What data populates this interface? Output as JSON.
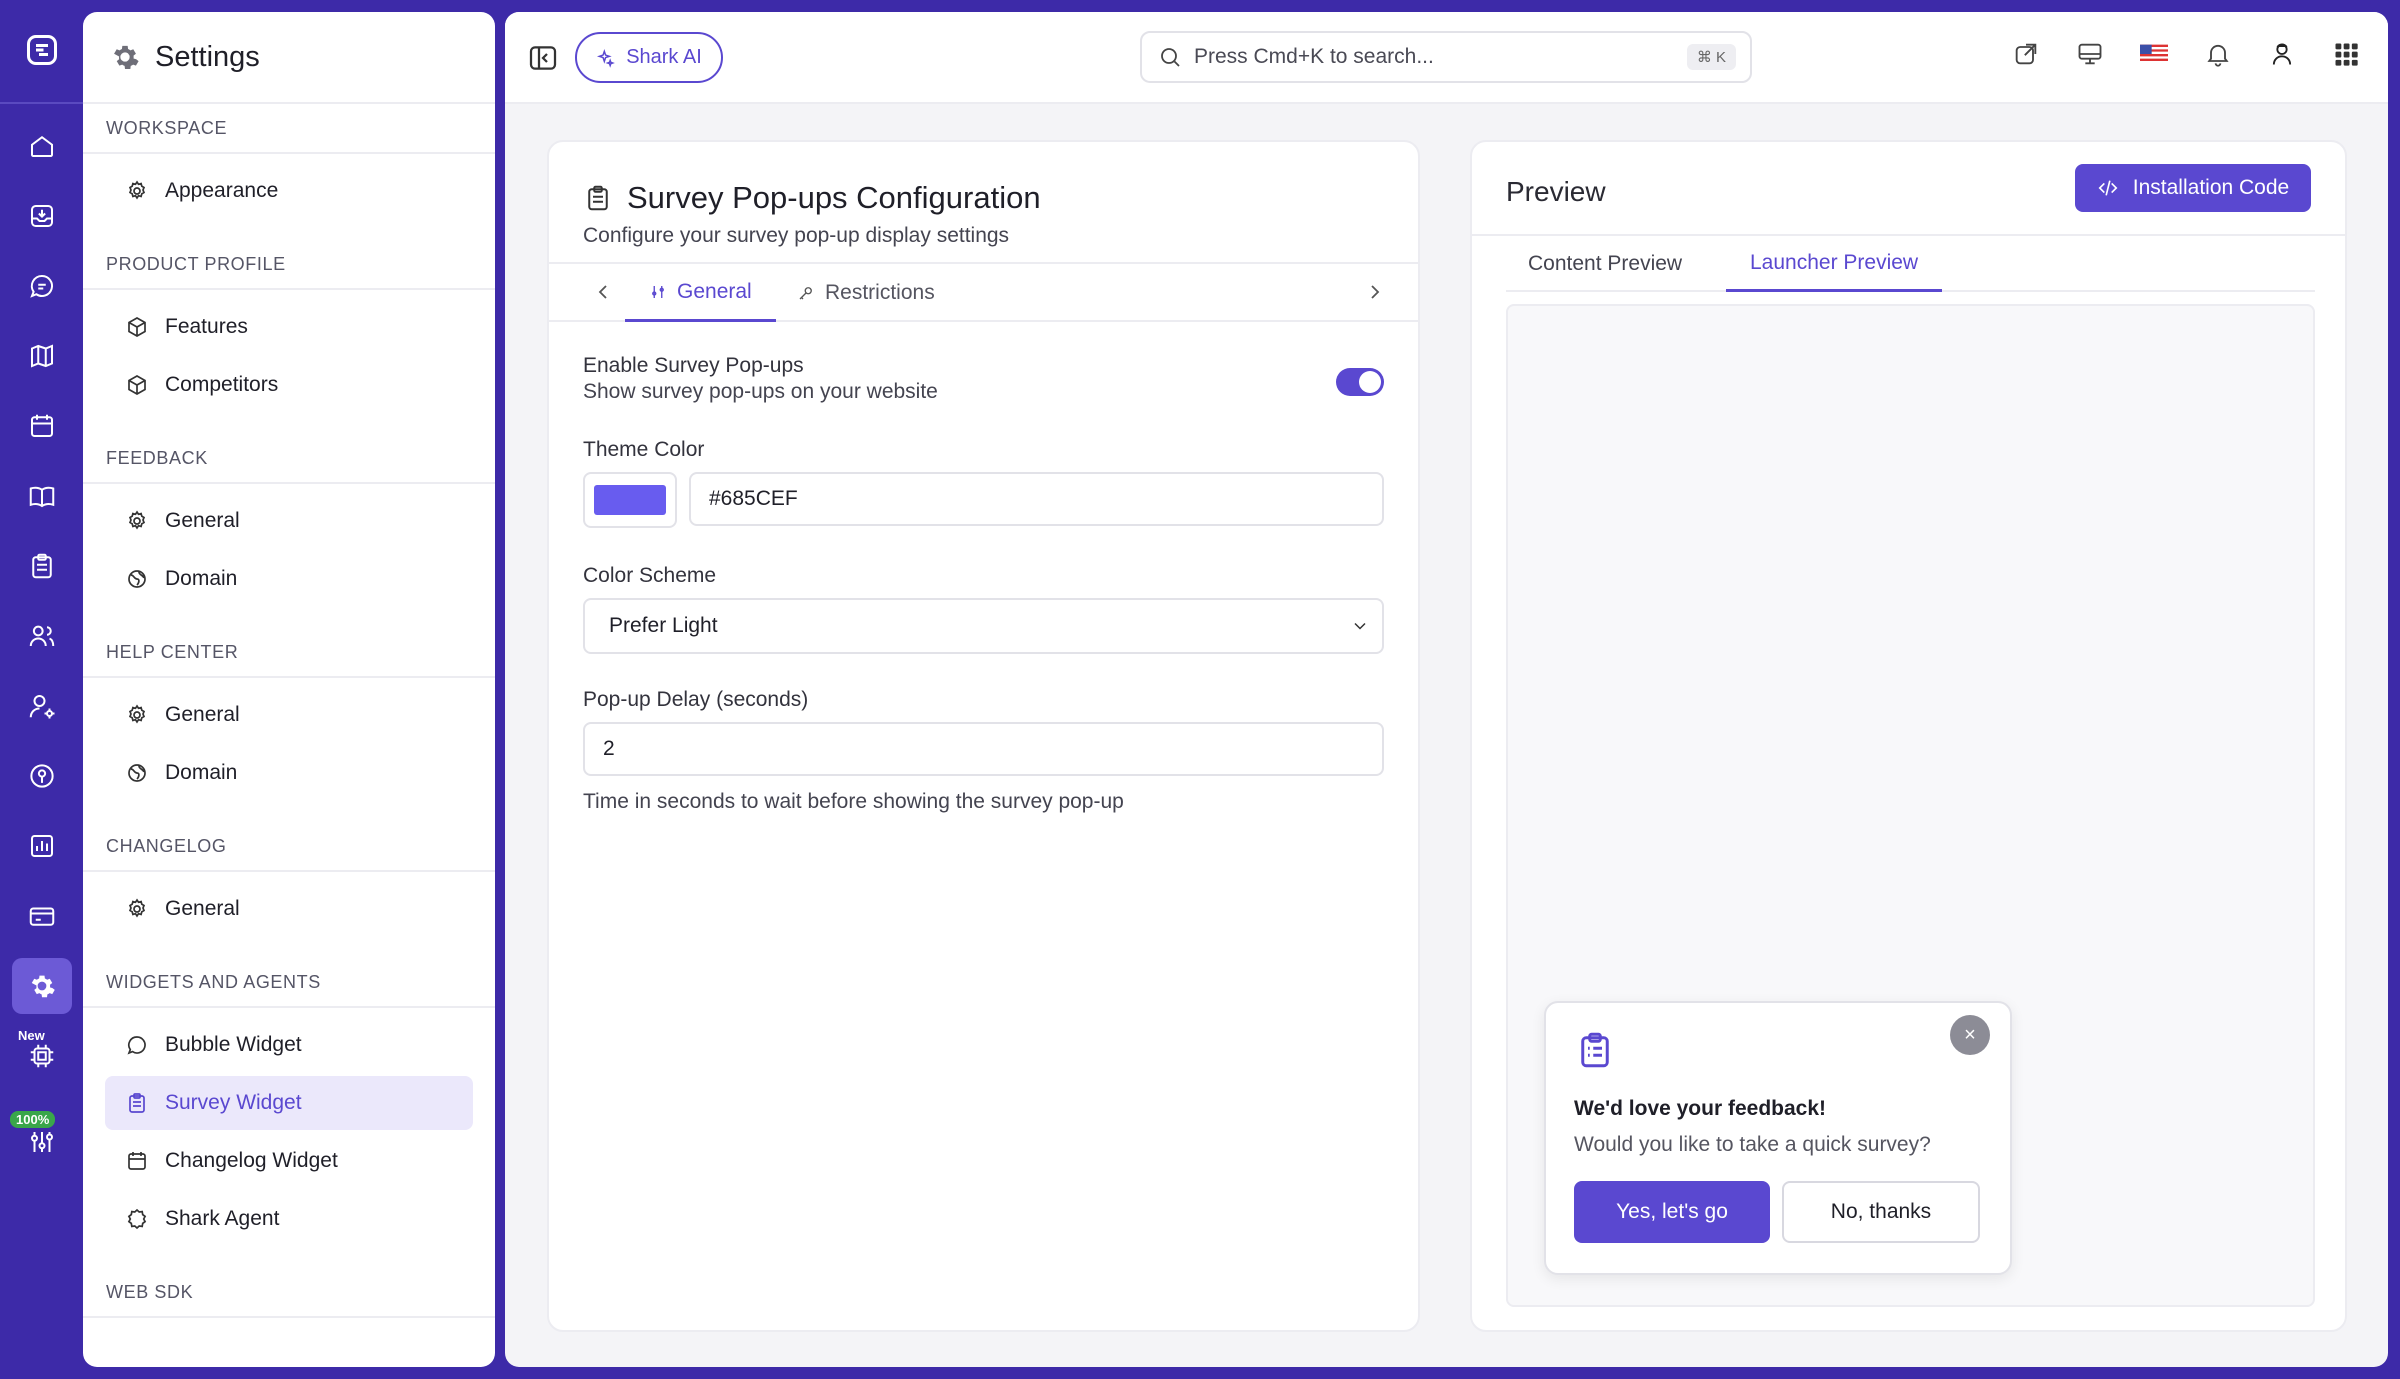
{
  "rail": {
    "new_badge": "New",
    "progress_badge": "100%"
  },
  "sidebar": {
    "title": "Settings",
    "sections": {
      "workspace": {
        "label": "WORKSPACE",
        "items": [
          "Appearance"
        ]
      },
      "product_profile": {
        "label": "PRODUCT PROFILE",
        "items": [
          "Features",
          "Competitors"
        ]
      },
      "feedback": {
        "label": "FEEDBACK",
        "items": [
          "General",
          "Domain"
        ]
      },
      "help_center": {
        "label": "HELP CENTER",
        "items": [
          "General",
          "Domain"
        ]
      },
      "changelog": {
        "label": "CHANGELOG",
        "items": [
          "General"
        ]
      },
      "widgets": {
        "label": "WIDGETS AND AGENTS",
        "items": [
          "Bubble Widget",
          "Survey Widget",
          "Changelog Widget",
          "Shark Agent"
        ]
      },
      "web_sdk": {
        "label": "WEB SDK"
      }
    }
  },
  "topbar": {
    "ai_button": "Shark AI",
    "search_placeholder": "Press Cmd+K to search...",
    "search_shortcut": "⌘ K"
  },
  "config": {
    "title": "Survey Pop-ups Configuration",
    "subtitle": "Configure your survey pop-up display settings",
    "tabs": [
      "General",
      "Restrictions"
    ],
    "enable": {
      "label": "Enable Survey Pop-ups",
      "description": "Show survey pop-ups on your website",
      "enabled": true
    },
    "theme_color": {
      "label": "Theme Color",
      "value": "#685CEF"
    },
    "color_scheme": {
      "label": "Color Scheme",
      "value": "Prefer Light"
    },
    "delay": {
      "label": "Pop-up Delay (seconds)",
      "value": "2",
      "help": "Time in seconds to wait before showing the survey pop-up"
    }
  },
  "preview": {
    "title": "Preview",
    "install_button": "Installation Code",
    "tabs": [
      "Content Preview",
      "Launcher Preview"
    ],
    "popup": {
      "close": "×",
      "title": "We'd love your feedback!",
      "question": "Would you like to take a quick survey?",
      "yes": "Yes, let's go",
      "no": "No, thanks"
    }
  },
  "colors": {
    "accent": "#5a48d0",
    "rail": "#3d2aa8",
    "theme": "#685cef"
  }
}
